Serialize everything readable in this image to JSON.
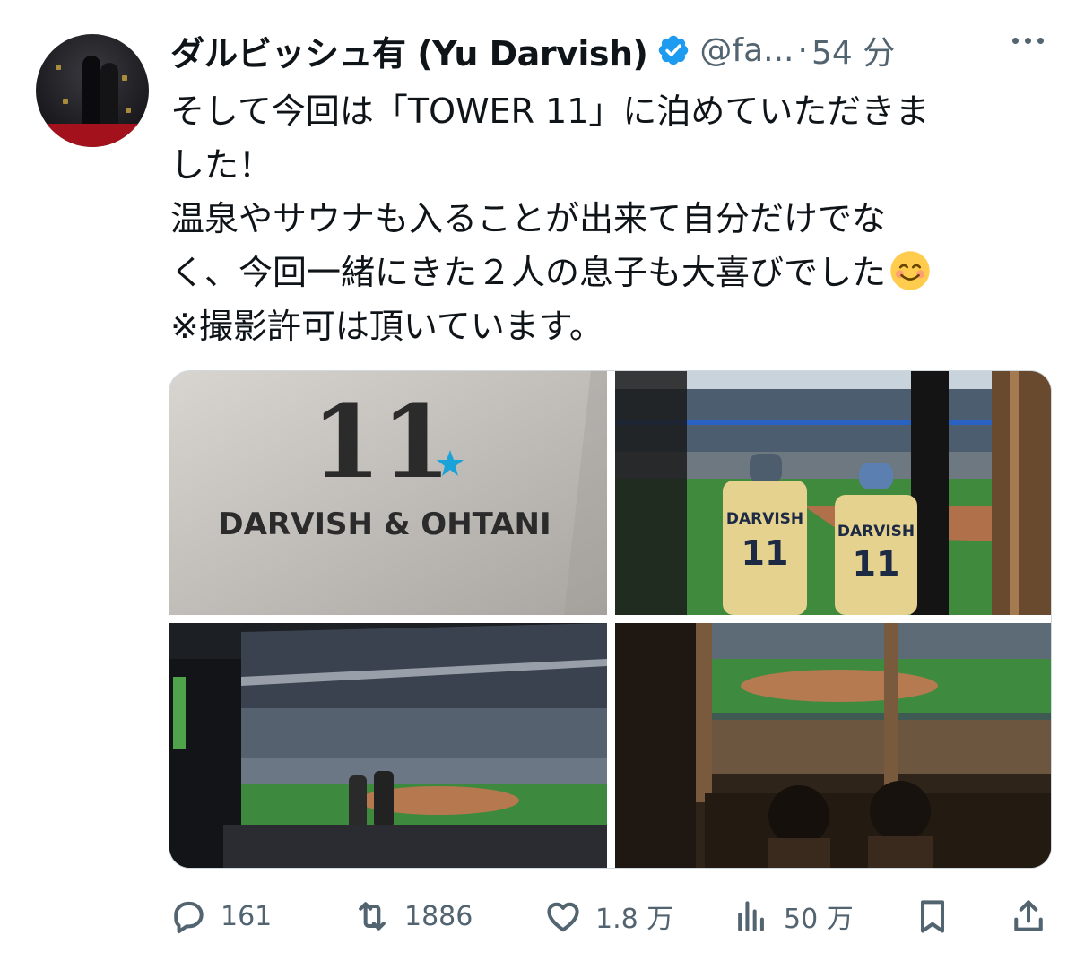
{
  "tweet": {
    "display_name": "ダルビッシュ有 (Yu Darvish)",
    "handle": "@fa...",
    "separator": "·",
    "time": "54 分",
    "text_lines": [
      "そして今回は「TOWER 11」に泊めていただきま",
      "した！",
      "温泉やサウナも入ることが出来て自分だけでな",
      "く、今回一緒にきた２人の息子も大喜びでした",
      "※撮影許可は頂いています。"
    ],
    "emoji": "smiling-face-emoji"
  },
  "media": {
    "photo1_text": {
      "number": "11",
      "names": "DARVISH & OHTANI"
    },
    "photo2_text": {
      "jersey_name": "DARVISH",
      "jersey_number": "11"
    }
  },
  "actions": {
    "reply_count": "161",
    "retweet_count": "1886",
    "like_count": "1.8 万",
    "views_count": "50 万"
  },
  "colors": {
    "text": "#0f1419",
    "secondary": "#536471",
    "verified": "#1d9bf0",
    "border": "#cfd9de"
  }
}
